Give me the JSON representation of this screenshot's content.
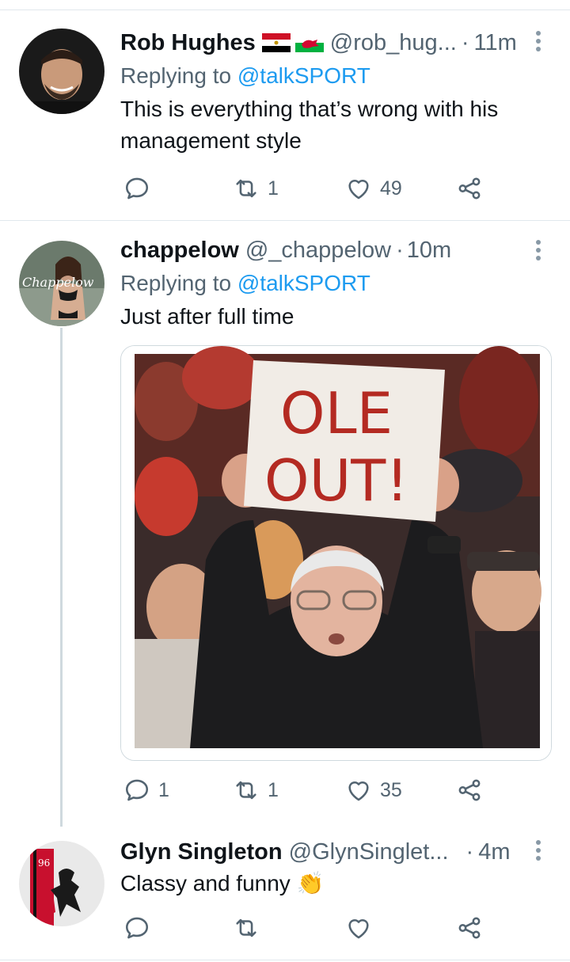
{
  "tweets": [
    {
      "name": "Rob Hughes",
      "handle": "@rob_hug...",
      "time": "11m",
      "replying_prefix": "Replying to ",
      "replying_to": "@talkSPORT",
      "text": "This is everything that’s wrong with his management style",
      "reply_count": "",
      "retweet_count": "1",
      "like_count": "49"
    },
    {
      "name": "chappelow",
      "handle": "@_chappelow",
      "time": "10m",
      "replying_prefix": "Replying to ",
      "replying_to": "@talkSPORT",
      "text": "Just after full time",
      "avatar_text": "Chappelow",
      "media_sign_line1": "OLE",
      "media_sign_line2": "OUT!",
      "reply_count": "1",
      "retweet_count": "1",
      "like_count": "35"
    },
    {
      "name": "Glyn Singleton",
      "handle": "@GlynSinglet...",
      "time": "4m",
      "text": "Classy and funny 👏",
      "avatar_text": "96",
      "reply_count": "",
      "retweet_count": "",
      "like_count": ""
    }
  ],
  "colors": {
    "accent": "#1d9bf0",
    "secondary_text": "#536471",
    "divider": "#e1e8ed"
  },
  "icons": [
    "more-icon",
    "reply-icon",
    "retweet-icon",
    "like-icon",
    "share-icon",
    "flag-egypt-icon",
    "flag-wales-icon"
  ]
}
